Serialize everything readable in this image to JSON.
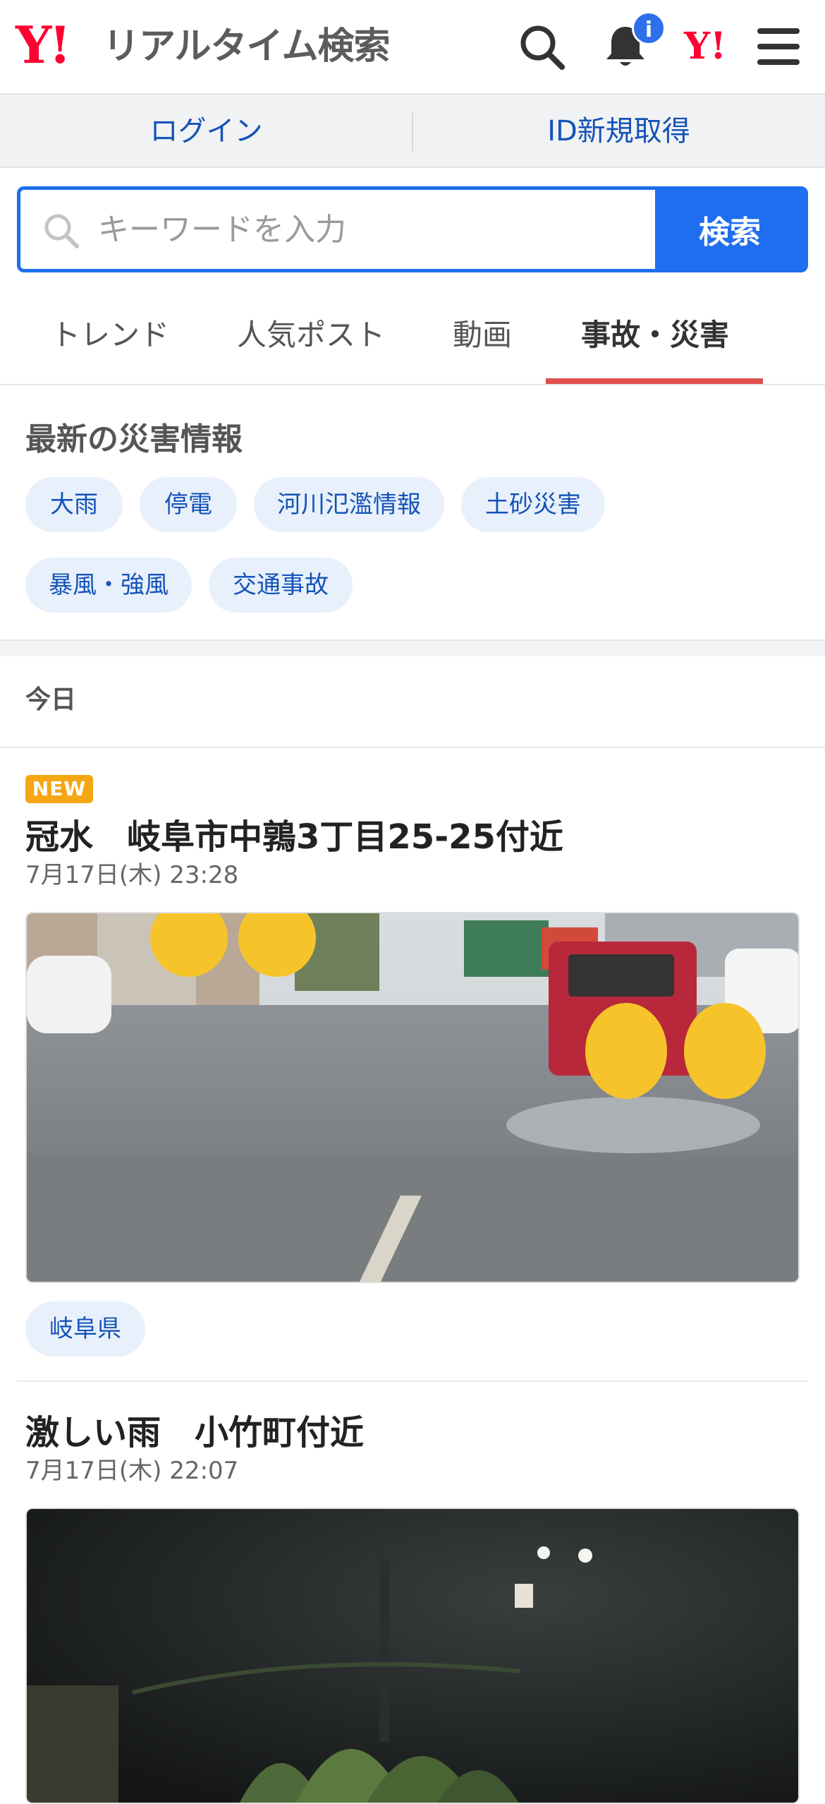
{
  "header": {
    "logo_y": "Y!",
    "logo_text": "リアルタイム検索",
    "notification_badge": "i",
    "yj_logo": "Y!",
    "icons": [
      "search-icon",
      "bell-icon",
      "menu-icon"
    ]
  },
  "account": {
    "login": "ログイン",
    "signup": "ID新規取得"
  },
  "search": {
    "placeholder": "キーワードを入力",
    "button": "検索"
  },
  "tabs": [
    {
      "label": "トレンド",
      "active": false
    },
    {
      "label": "人気ポスト",
      "active": false
    },
    {
      "label": "動画",
      "active": false
    },
    {
      "label": "事故・災害",
      "active": true
    }
  ],
  "disaster": {
    "title": "最新の災害情報",
    "chips": [
      "大雨",
      "停電",
      "河川氾濫情報",
      "土砂災害",
      "暴風・強風",
      "交通事故"
    ]
  },
  "feed": {
    "day_label": "今日",
    "posts": [
      {
        "new_label": "NEW",
        "title": "冠水　岐阜市中鶉3丁目25-25付近",
        "date": "7月17日(木) 23:28",
        "tag": "岐阜県"
      },
      {
        "title": "激しい雨　小竹町付近",
        "date": "7月17日(木) 22:07"
      }
    ]
  },
  "colors": {
    "accent": "#1f6ef0",
    "brand": "#ff0033",
    "tab_active": "#e0504a",
    "chip_bg": "#e8f0fb",
    "new_badge": "#f4a615"
  }
}
